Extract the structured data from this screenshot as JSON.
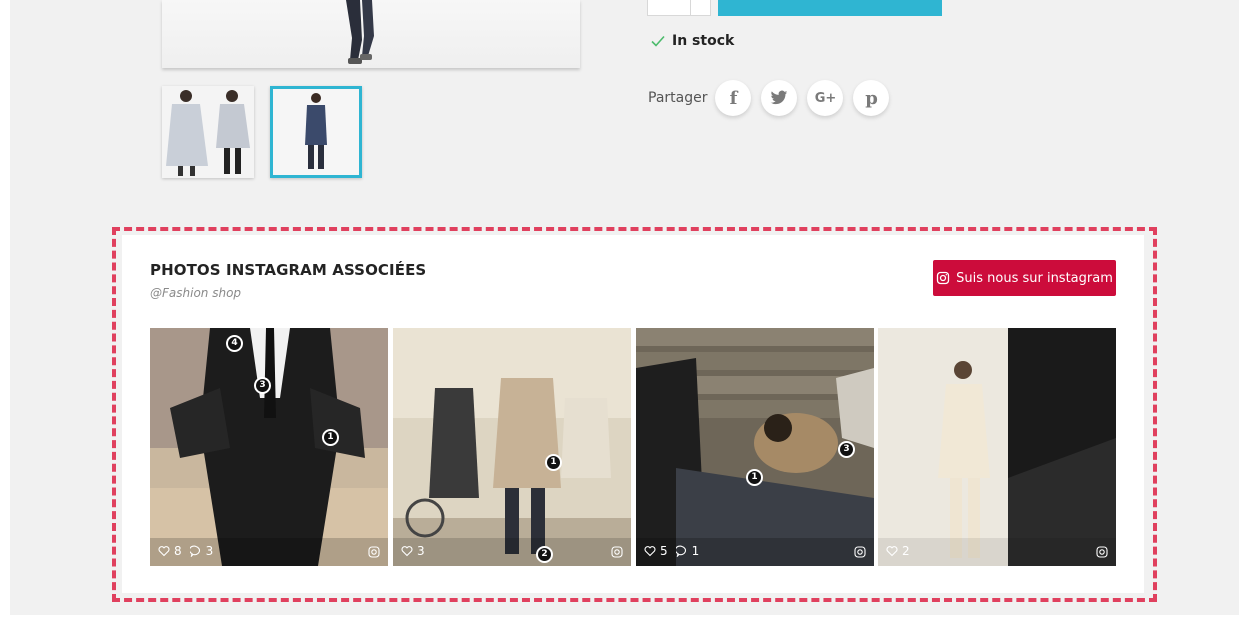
{
  "product": {
    "stock_label": "In stock",
    "share_label": "Partager",
    "social": [
      "f",
      "t",
      "G+",
      "p"
    ]
  },
  "instagram": {
    "title": "PHOTOS INSTAGRAM ASSOCIÉES",
    "subtitle": "@Fashion shop",
    "follow_label": "Suis nous sur instagram",
    "accent_color": "#cc0c3b",
    "highlight_color": "#e0405e",
    "photos": [
      {
        "likes": "8",
        "comments": "3",
        "tags": [
          "4",
          "3",
          "1"
        ]
      },
      {
        "likes": "3",
        "comments": "",
        "tags": [
          "1",
          "2"
        ]
      },
      {
        "likes": "5",
        "comments": "1",
        "tags": [
          "3",
          "1"
        ]
      },
      {
        "likes": "2",
        "comments": "",
        "tags": []
      }
    ]
  }
}
